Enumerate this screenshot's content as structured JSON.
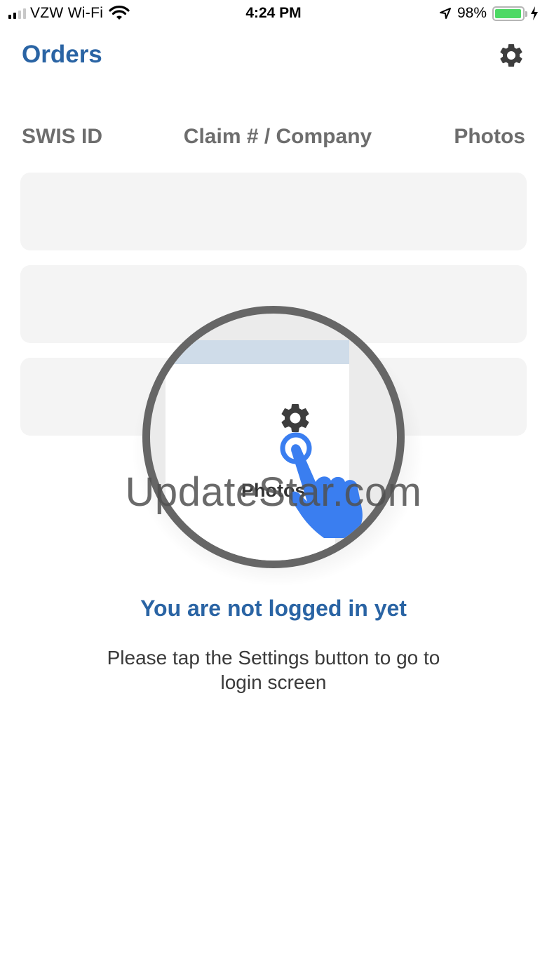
{
  "status_bar": {
    "carrier": "VZW Wi-Fi",
    "time": "4:24 PM",
    "battery_percent": "98%",
    "battery_level": 0.98,
    "signal_bars_active": 2,
    "signal_bars_total": 4,
    "icons": [
      "signal-icon",
      "wifi-icon",
      "location-icon",
      "battery-icon",
      "charging-icon"
    ]
  },
  "header": {
    "title": "Orders",
    "settings_icon": "gear-icon"
  },
  "columns": {
    "swis_id": "SWIS ID",
    "claim_company": "Claim # / Company",
    "photos": "Photos"
  },
  "placeholder_rows": 3,
  "tutorial": {
    "magnified_label": "Photos",
    "icons": [
      "gear-icon",
      "tap-hand-icon"
    ]
  },
  "watermark": "UpdateStar.com",
  "message": {
    "title": "You are not logged in yet",
    "body": "Please tap the Settings button to go to login screen"
  },
  "colors": {
    "accent": "#2a64a4",
    "header_text": "#6d6d6d",
    "hand": "#3a7ef0",
    "battery": "#4cd964"
  }
}
